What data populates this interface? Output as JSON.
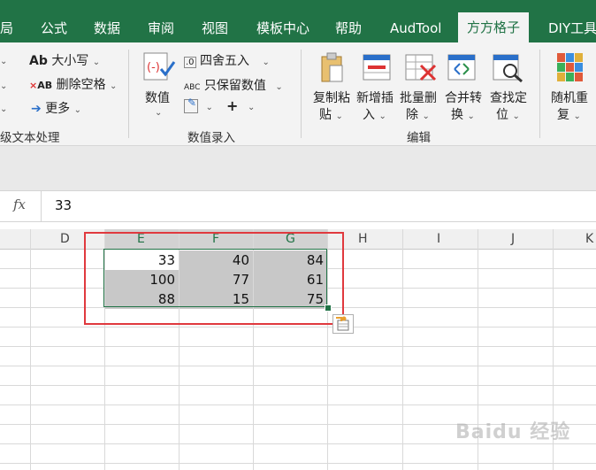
{
  "tabs": [
    "局",
    "公式",
    "数据",
    "审阅",
    "视图",
    "模板中心",
    "帮助",
    "AudTool",
    "方方格子",
    "DIY工具"
  ],
  "ribbon": {
    "text_group": {
      "case_label": "大小写",
      "case_prefix": "Ab",
      "remove_space_label": "删除空格",
      "more_label": "更多",
      "group_label": "级文本处理"
    },
    "number_group": {
      "value_label": "数值",
      "round_label": "四舍五入",
      "keep_value_label": "只保留数值",
      "abc_prefix": "ABC",
      "group_label": "数值录入"
    },
    "edit_group": {
      "copy_paste_1": "复制粘",
      "copy_paste_2": "贴",
      "insert_1": "新增插",
      "insert_2": "入",
      "delete_1": "批量删",
      "delete_2": "除",
      "merge_1": "合并转",
      "merge_2": "换",
      "find_1": "查找定",
      "find_2": "位",
      "group_label": "编辑"
    },
    "random_group": {
      "random_1": "随机重",
      "random_2": "复"
    }
  },
  "formula_bar": {
    "fx": "fx",
    "value": "33"
  },
  "columns": [
    "D",
    "E",
    "F",
    "G",
    "H",
    "I",
    "J",
    "K"
  ],
  "cells": {
    "r1": [
      "33",
      "40",
      "84"
    ],
    "r2": [
      "100",
      "77",
      "61"
    ],
    "r3": [
      "88",
      "15",
      "75"
    ]
  },
  "colors": {
    "ribbon_green": "#217346",
    "selection_red": "#e0393e",
    "selection_shade": "#c8c8c8"
  },
  "watermark": "Baidu 经验"
}
